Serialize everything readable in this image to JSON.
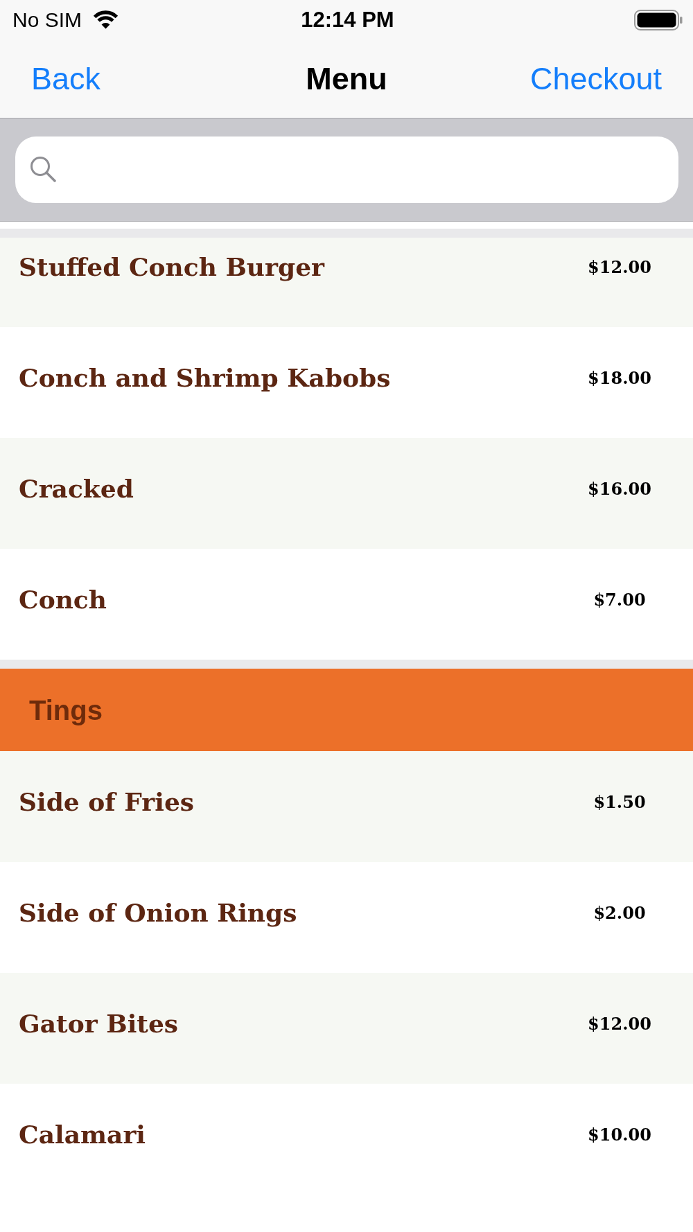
{
  "status_bar": {
    "carrier": "No SIM",
    "time": "12:14 PM"
  },
  "nav_bar": {
    "back": "Back",
    "title": "Menu",
    "action": "Checkout"
  },
  "sections": [
    {
      "items": [
        {
          "name": "Stuffed Conch Burger",
          "price": "$12.00"
        },
        {
          "name": "Conch and Shrimp Kabobs",
          "price": "$18.00"
        },
        {
          "name": "Cracked",
          "price": "$16.00"
        },
        {
          "name": "Conch",
          "price": "$7.00"
        }
      ]
    },
    {
      "title": "Tings",
      "items": [
        {
          "name": "Side of Fries",
          "price": "$1.50"
        },
        {
          "name": "Side of Onion Rings",
          "price": "$2.00"
        },
        {
          "name": "Gator Bites",
          "price": "$12.00"
        },
        {
          "name": "Calamari",
          "price": "$10.00"
        }
      ]
    }
  ]
}
